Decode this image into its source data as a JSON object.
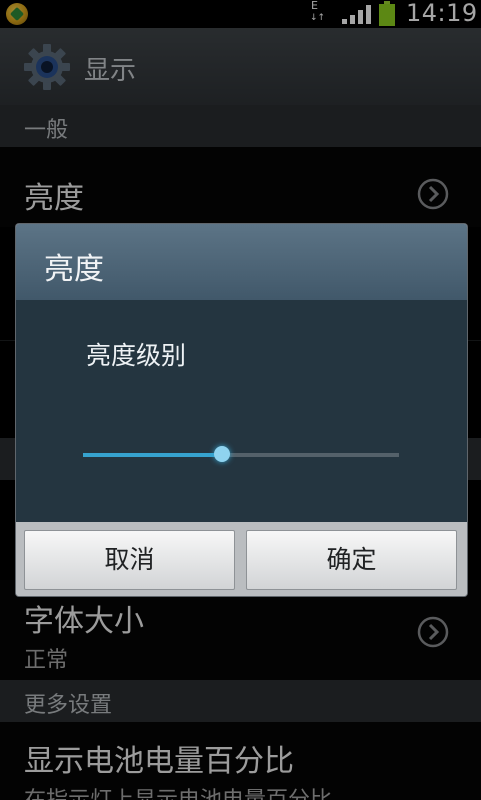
{
  "status_bar": {
    "network": "E",
    "network_arrows": "↓↑",
    "time": "14:19"
  },
  "title_bar": {
    "title": "显示"
  },
  "sections": {
    "general": "一般",
    "more_settings": "更多设置"
  },
  "rows": {
    "brightness": {
      "title": "亮度"
    },
    "font_size": {
      "title": "字体大小",
      "subtitle": "正常"
    },
    "battery_percent": {
      "title": "显示电池电量百分比",
      "subtitle": "在指示灯上显示电池电量百分比"
    }
  },
  "dialog": {
    "title": "亮度",
    "label": "亮度级别",
    "brightness_level_fraction": 0.44,
    "cancel_label": "取消",
    "ok_label": "确定"
  },
  "colors": {
    "accent": "#36a3cf",
    "dialog_header": "#4d6577",
    "dialog_body": "#243540"
  }
}
